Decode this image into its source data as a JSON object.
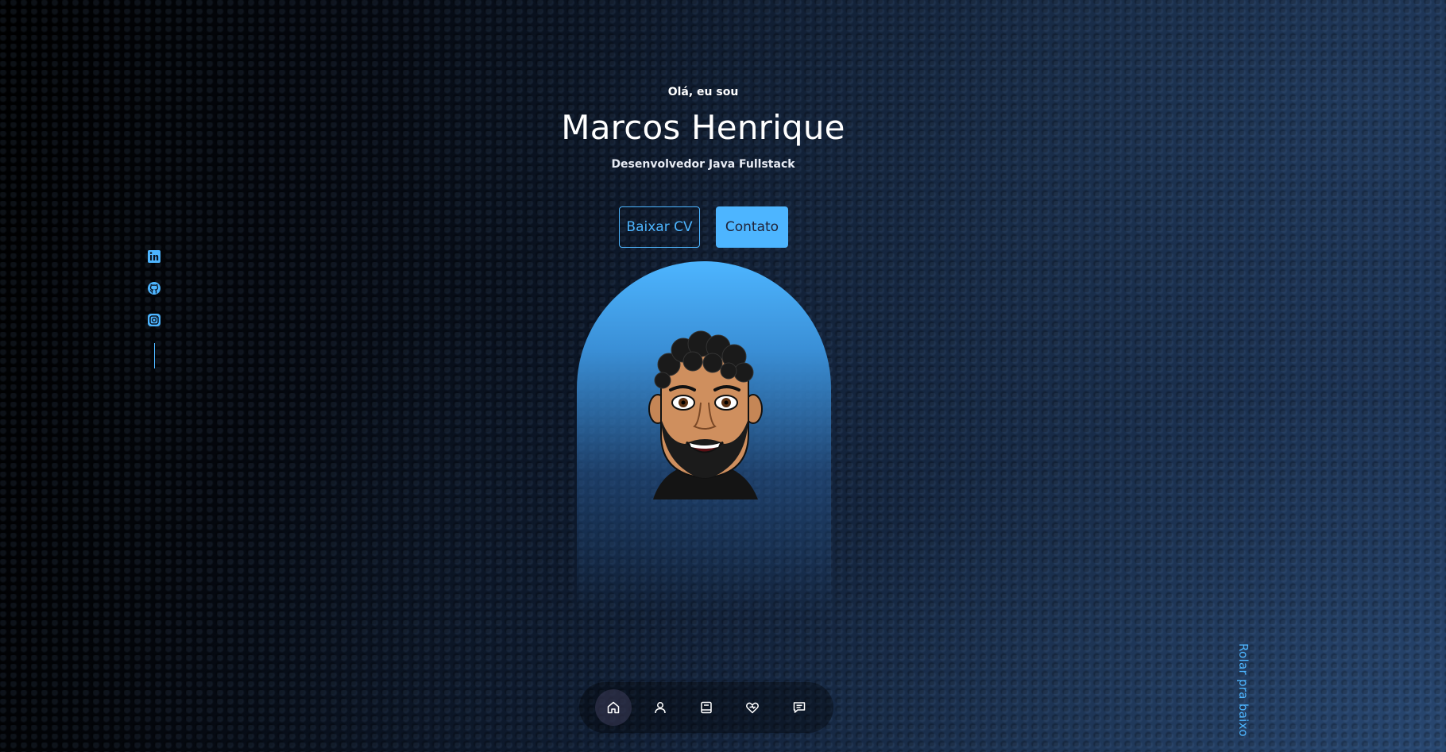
{
  "hero": {
    "greeting": "Olá, eu sou",
    "name": "Marcos Henrique",
    "role": "Desenvolvedor Java Fullstack"
  },
  "buttons": {
    "download_cv": "Baixar CV",
    "contact": "Contato"
  },
  "socials": [
    {
      "icon": "linkedin-icon"
    },
    {
      "icon": "github-icon"
    },
    {
      "icon": "instagram-icon"
    }
  ],
  "scroll_hint": "Rolar pra baixo",
  "nav": {
    "items": [
      {
        "icon": "home-icon",
        "active": true
      },
      {
        "icon": "user-icon",
        "active": false
      },
      {
        "icon": "book-icon",
        "active": false
      },
      {
        "icon": "services-icon",
        "active": false
      },
      {
        "icon": "message-icon",
        "active": false
      }
    ]
  },
  "colors": {
    "accent": "#4db5ff",
    "button_text_dark": "#1f2236",
    "background_dark": "#000000",
    "background_blue": "#1b3050"
  }
}
